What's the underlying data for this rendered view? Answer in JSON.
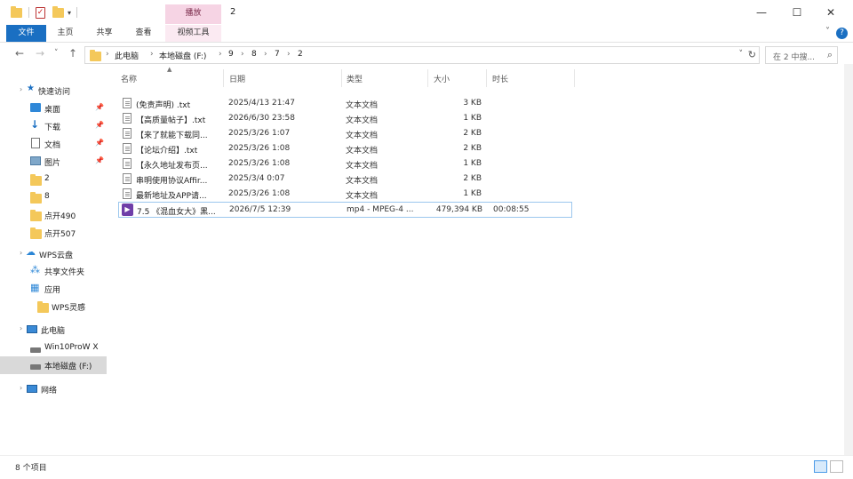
{
  "window": {
    "title": "2",
    "tool_tab_header": "播放",
    "controls": {
      "minimize": "—",
      "maximize": "☐",
      "close": "✕"
    }
  },
  "ribbon": {
    "tabs": [
      "文件",
      "主页",
      "共享",
      "查看",
      "视频工具"
    ]
  },
  "address": {
    "crumbs": [
      "此电脑",
      "本地磁盘 (F:)",
      "9",
      "8",
      "7",
      "2"
    ],
    "search_placeholder": "在 2 中搜..."
  },
  "sidebar": {
    "quick_access": "快速访问",
    "items": [
      {
        "label": "桌面",
        "pinned": true
      },
      {
        "label": "下载",
        "pinned": true
      },
      {
        "label": "文档",
        "pinned": true
      },
      {
        "label": "图片",
        "pinned": true
      },
      {
        "label": "2"
      },
      {
        "label": "8"
      },
      {
        "label": "点开490"
      },
      {
        "label": "点开507"
      }
    ],
    "wps_cloud": "WPS云盘",
    "wps_items": [
      "共享文件夹",
      "应用",
      "WPS灵感"
    ],
    "this_pc": "此电脑",
    "pc_items": [
      "Win10ProW X",
      "本地磁盘 (F:)"
    ],
    "network": "网络"
  },
  "columns": [
    "名称",
    "日期",
    "类型",
    "大小",
    "时长"
  ],
  "files": [
    {
      "name": "(免责声明) .txt",
      "date": "2025/4/13 21:47",
      "type": "文本文档",
      "size": "3 KB",
      "duration": "",
      "kind": "txt"
    },
    {
      "name": "【高质量帖子】.txt",
      "date": "2026/6/30 23:58",
      "type": "文本文档",
      "size": "1 KB",
      "duration": "",
      "kind": "txt"
    },
    {
      "name": "【来了就能下载同...",
      "date": "2025/3/26 1:07",
      "type": "文本文档",
      "size": "2 KB",
      "duration": "",
      "kind": "txt"
    },
    {
      "name": "【论坛介绍】.txt",
      "date": "2025/3/26 1:08",
      "type": "文本文档",
      "size": "2 KB",
      "duration": "",
      "kind": "txt"
    },
    {
      "name": "【永久地址发布页...",
      "date": "2025/3/26 1:08",
      "type": "文本文档",
      "size": "1 KB",
      "duration": "",
      "kind": "txt"
    },
    {
      "name": "串明使用协议Affir...",
      "date": "2025/3/4 0:07",
      "type": "文本文档",
      "size": "2 KB",
      "duration": "",
      "kind": "txt"
    },
    {
      "name": "最新地址及APP请...",
      "date": "2025/3/26 1:08",
      "type": "文本文档",
      "size": "1 KB",
      "duration": "",
      "kind": "txt"
    },
    {
      "name": "7.5 《混血女大》黑...",
      "date": "2026/7/5 12:39",
      "type": "mp4 - MPEG-4 ...",
      "size": "479,394 KB",
      "duration": "00:08:55",
      "kind": "video"
    }
  ],
  "status": {
    "count": "8 个项目"
  },
  "icons": {
    "back": "←",
    "forward": "→",
    "recent": "˅",
    "up": "↑",
    "refresh": "↻",
    "search": "⌕",
    "help": "?",
    "video_badge": "▶"
  }
}
